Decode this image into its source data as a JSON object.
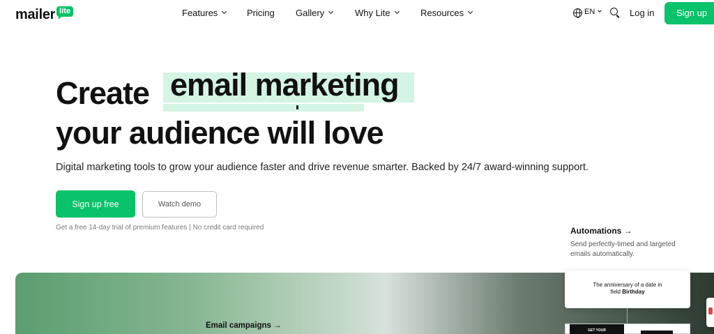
{
  "nav": {
    "logo": {
      "word": "mailer",
      "badge": "lite"
    },
    "menu": [
      {
        "label": "Features",
        "has_dropdown": true
      },
      {
        "label": "Pricing",
        "has_dropdown": false
      },
      {
        "label": "Gallery",
        "has_dropdown": true
      },
      {
        "label": "Why Lite",
        "has_dropdown": true
      },
      {
        "label": "Resources",
        "has_dropdown": true
      }
    ],
    "language": "EN",
    "login_label": "Log in",
    "signup_label": "Sign up"
  },
  "hero": {
    "title_prefix": "Create",
    "title_highlight": "email marketing",
    "title_line2": "your audience will love",
    "subtitle": "Digital marketing tools to grow your audience faster and drive revenue smarter. Backed by 24/7 award-winning support.",
    "primary_button": "Sign up free",
    "secondary_button": "Watch demo",
    "trial_note": "Get a free 14-day trial of premium features | No credit card required"
  },
  "automations": {
    "title": "Automations →",
    "description": "Send perfectly-timed and targeted emails automatically."
  },
  "banner": {
    "email_campaigns_title": "Email campaigns →",
    "trigger_card_text": "The anniversary of a date in",
    "trigger_card_field_prefix": "field",
    "trigger_card_field": "Birthday",
    "email_preview_text": "GET YOUR"
  },
  "colors": {
    "brand_green": "#09c269",
    "highlight_mint": "#d4f4e4",
    "text_dark": "#111111"
  }
}
